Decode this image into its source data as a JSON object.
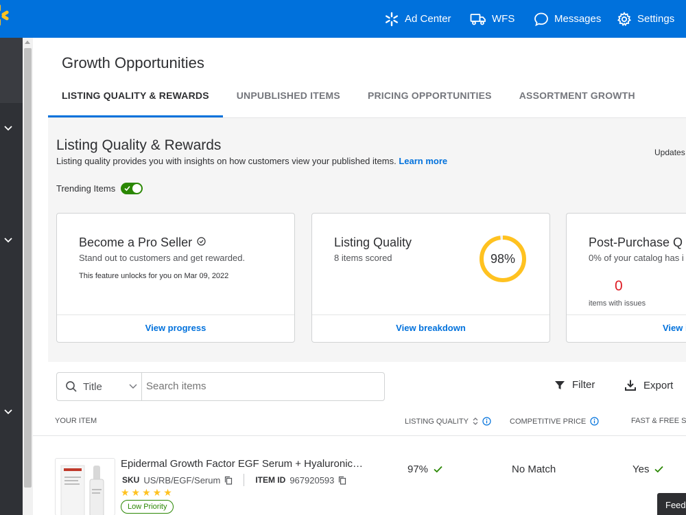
{
  "topbar": {
    "items": [
      {
        "label": "Ad Center",
        "icon": "spark-icon"
      },
      {
        "label": "WFS",
        "icon": "truck-icon"
      },
      {
        "label": "Messages",
        "icon": "chat-icon"
      },
      {
        "label": "Settings",
        "icon": "gear-icon"
      }
    ],
    "brand_color": "#0071dc"
  },
  "page": {
    "title": "Growth Opportunities",
    "tabs": [
      {
        "label": "LISTING QUALITY & REWARDS",
        "active": true
      },
      {
        "label": "UNPUBLISHED ITEMS",
        "active": false
      },
      {
        "label": "PRICING OPPORTUNITIES",
        "active": false
      },
      {
        "label": "ASSORTMENT GROWTH",
        "active": false
      }
    ]
  },
  "section": {
    "title": "Listing Quality & Rewards",
    "subtitle": "Listing quality provides you with insights on how customers view your published items.",
    "learn_more": "Learn more",
    "updates_label": "Updates",
    "trending_label": "Trending Items",
    "trending_on": true
  },
  "cards": [
    {
      "title": "Become a Pro Seller",
      "subtitle": "Stand out to customers and get rewarded.",
      "note": "This feature unlocks for you on Mar 09, 2022",
      "action": "View progress"
    },
    {
      "title": "Listing Quality",
      "subtitle": "8 items scored",
      "score_label": "98%",
      "score_value": 98,
      "action": "View breakdown"
    },
    {
      "title": "Post-Purchase Q",
      "subtitle": "0% of your catalog has i",
      "count": "0",
      "count_label": "items with issues",
      "action": "View i"
    }
  ],
  "toolbar": {
    "search_field": "Title",
    "search_placeholder": "Search items",
    "filter_label": "Filter",
    "export_label": "Export"
  },
  "table": {
    "headers": {
      "item": "YOUR ITEM",
      "listing_quality": "LISTING QUALITY",
      "competitive_price": "COMPETITIVE PRICE",
      "fast_free": "FAST & FREE SH"
    },
    "rows": [
      {
        "name": "Epidermal Growth Factor EGF Serum + Hyaluronic…",
        "sku_label": "SKU",
        "sku": "US/RB/EGF/Serum",
        "item_id_label": "ITEM ID",
        "item_id": "967920593",
        "rating": 5,
        "stars": "★★★★★",
        "priority": "Low Priority",
        "listing_quality": "97%",
        "competitive_price": "No Match",
        "fast_free": "Yes"
      }
    ]
  },
  "feedback_label": "Feedb"
}
